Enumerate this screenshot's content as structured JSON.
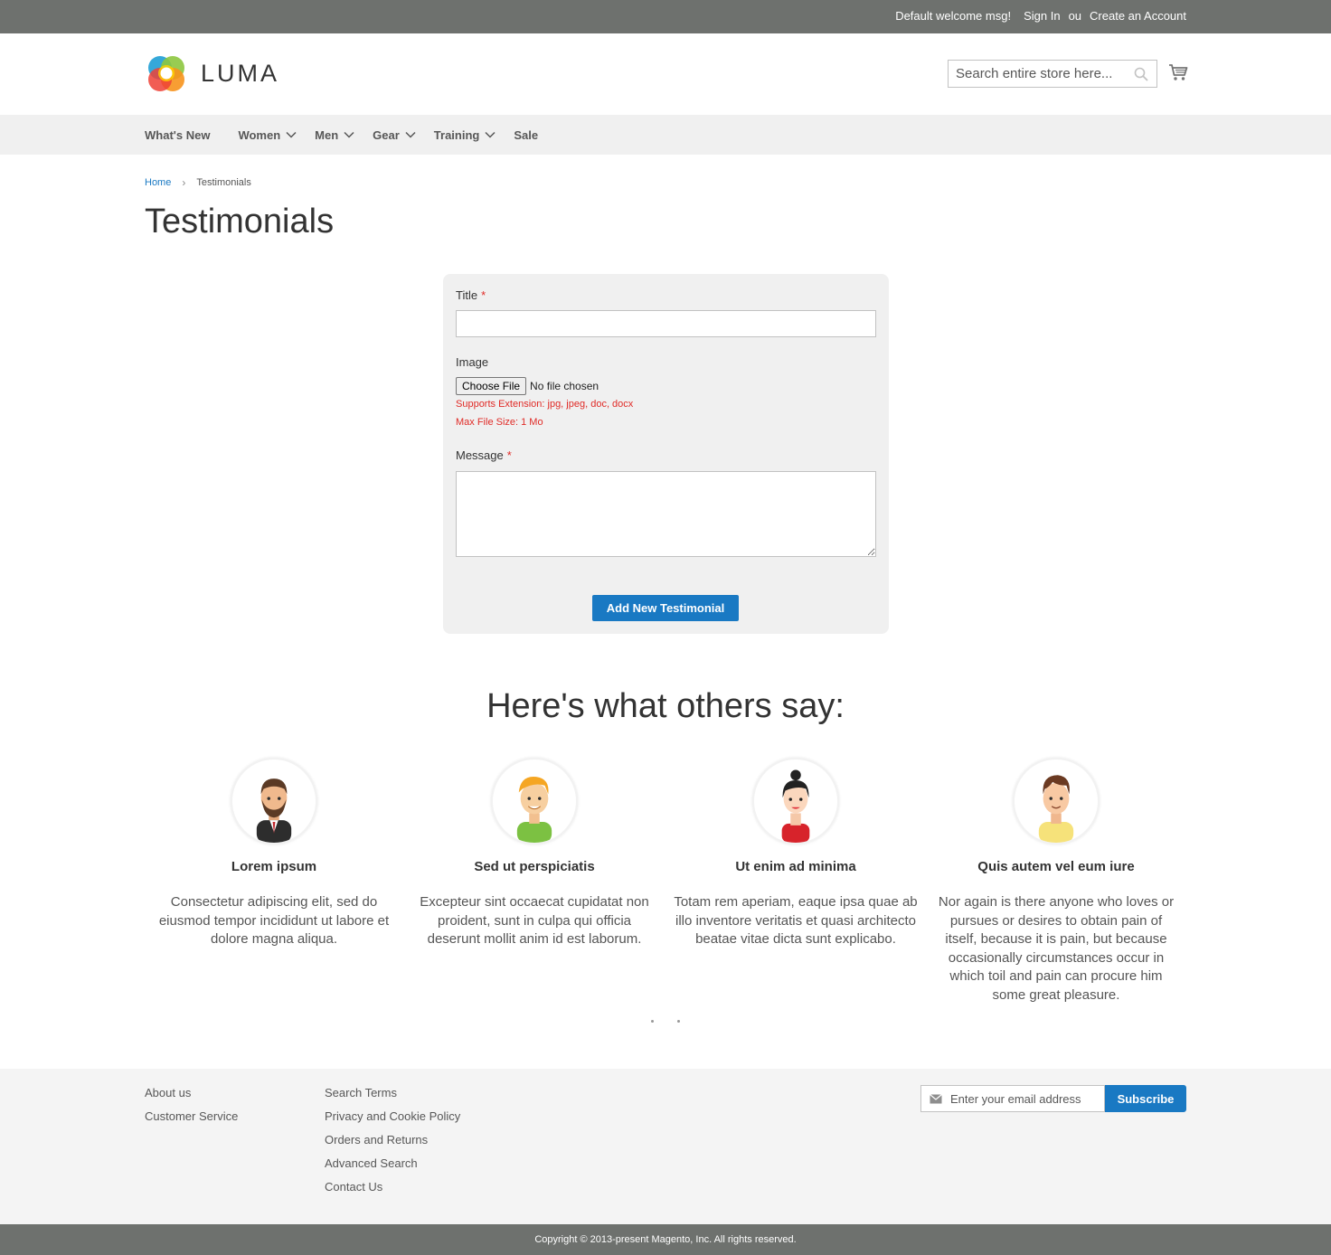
{
  "topbar": {
    "welcome": "Default welcome msg!",
    "sign_in": "Sign In",
    "or": "ou",
    "create_account": "Create an Account"
  },
  "header": {
    "logo_text": "LUMA",
    "search_placeholder": "Search entire store here...",
    "icons": [
      "luma-logo",
      "search-icon",
      "cart-icon"
    ]
  },
  "nav": {
    "items": [
      {
        "label": "What's New",
        "has_dropdown": false
      },
      {
        "label": "Women",
        "has_dropdown": true
      },
      {
        "label": "Men",
        "has_dropdown": true
      },
      {
        "label": "Gear",
        "has_dropdown": true
      },
      {
        "label": "Training",
        "has_dropdown": true
      },
      {
        "label": "Sale",
        "has_dropdown": false
      }
    ]
  },
  "breadcrumb": {
    "home": "Home",
    "separator": "›",
    "current": "Testimonials"
  },
  "page_title": "Testimonials",
  "form": {
    "title_label": "Title",
    "required_mark": "*",
    "title_value": "",
    "image_label": "Image",
    "choose_file": "Choose File",
    "no_file": "No file chosen",
    "supports_ext": "Supports Extension: jpg, jpeg, doc, docx",
    "max_size": "Max File Size: 1 Mo",
    "message_label": "Message",
    "message_value": "",
    "submit": "Add New Testimonial"
  },
  "others": {
    "title": "Here's what others say:",
    "items": [
      {
        "name": "Lorem ipsum",
        "text": "Consectetur adipiscing elit, sed do eiusmod tempor incididunt ut labore et dolore magna aliqua.",
        "avatar": "bearded-man-avatar"
      },
      {
        "name": "Sed ut perspiciatis",
        "text": "Excepteur sint occaecat cupidatat non proident, sunt in culpa qui officia deserunt mollit anim id est laborum.",
        "avatar": "blond-man-avatar"
      },
      {
        "name": "Ut enim ad minima",
        "text": "Totam rem aperiam, eaque ipsa quae ab illo inventore veritatis et quasi architecto beatae vitae dicta sunt explicabo.",
        "avatar": "woman-avatar"
      },
      {
        "name": "Quis autem vel eum iure",
        "text": "Nor again is there anyone who loves or pursues or desires to obtain pain of itself, because it is pain, but because occasionally circumstances occur in which toil and pain can procure him some great pleasure.",
        "avatar": "young-man-avatar"
      }
    ]
  },
  "footer": {
    "col1": [
      "About us",
      "Customer Service"
    ],
    "col2": [
      "Search Terms",
      "Privacy and Cookie Policy",
      "Orders and Returns",
      "Advanced Search",
      "Contact Us"
    ],
    "newsletter_placeholder": "Enter your email address",
    "subscribe": "Subscribe",
    "copyright": "Copyright © 2013-present Magento, Inc. All rights reserved."
  },
  "colors": {
    "topbar_bg": "#6e716e",
    "nav_bg": "#f0f0f0",
    "accent": "#1979c3",
    "required": "#e02b27"
  }
}
